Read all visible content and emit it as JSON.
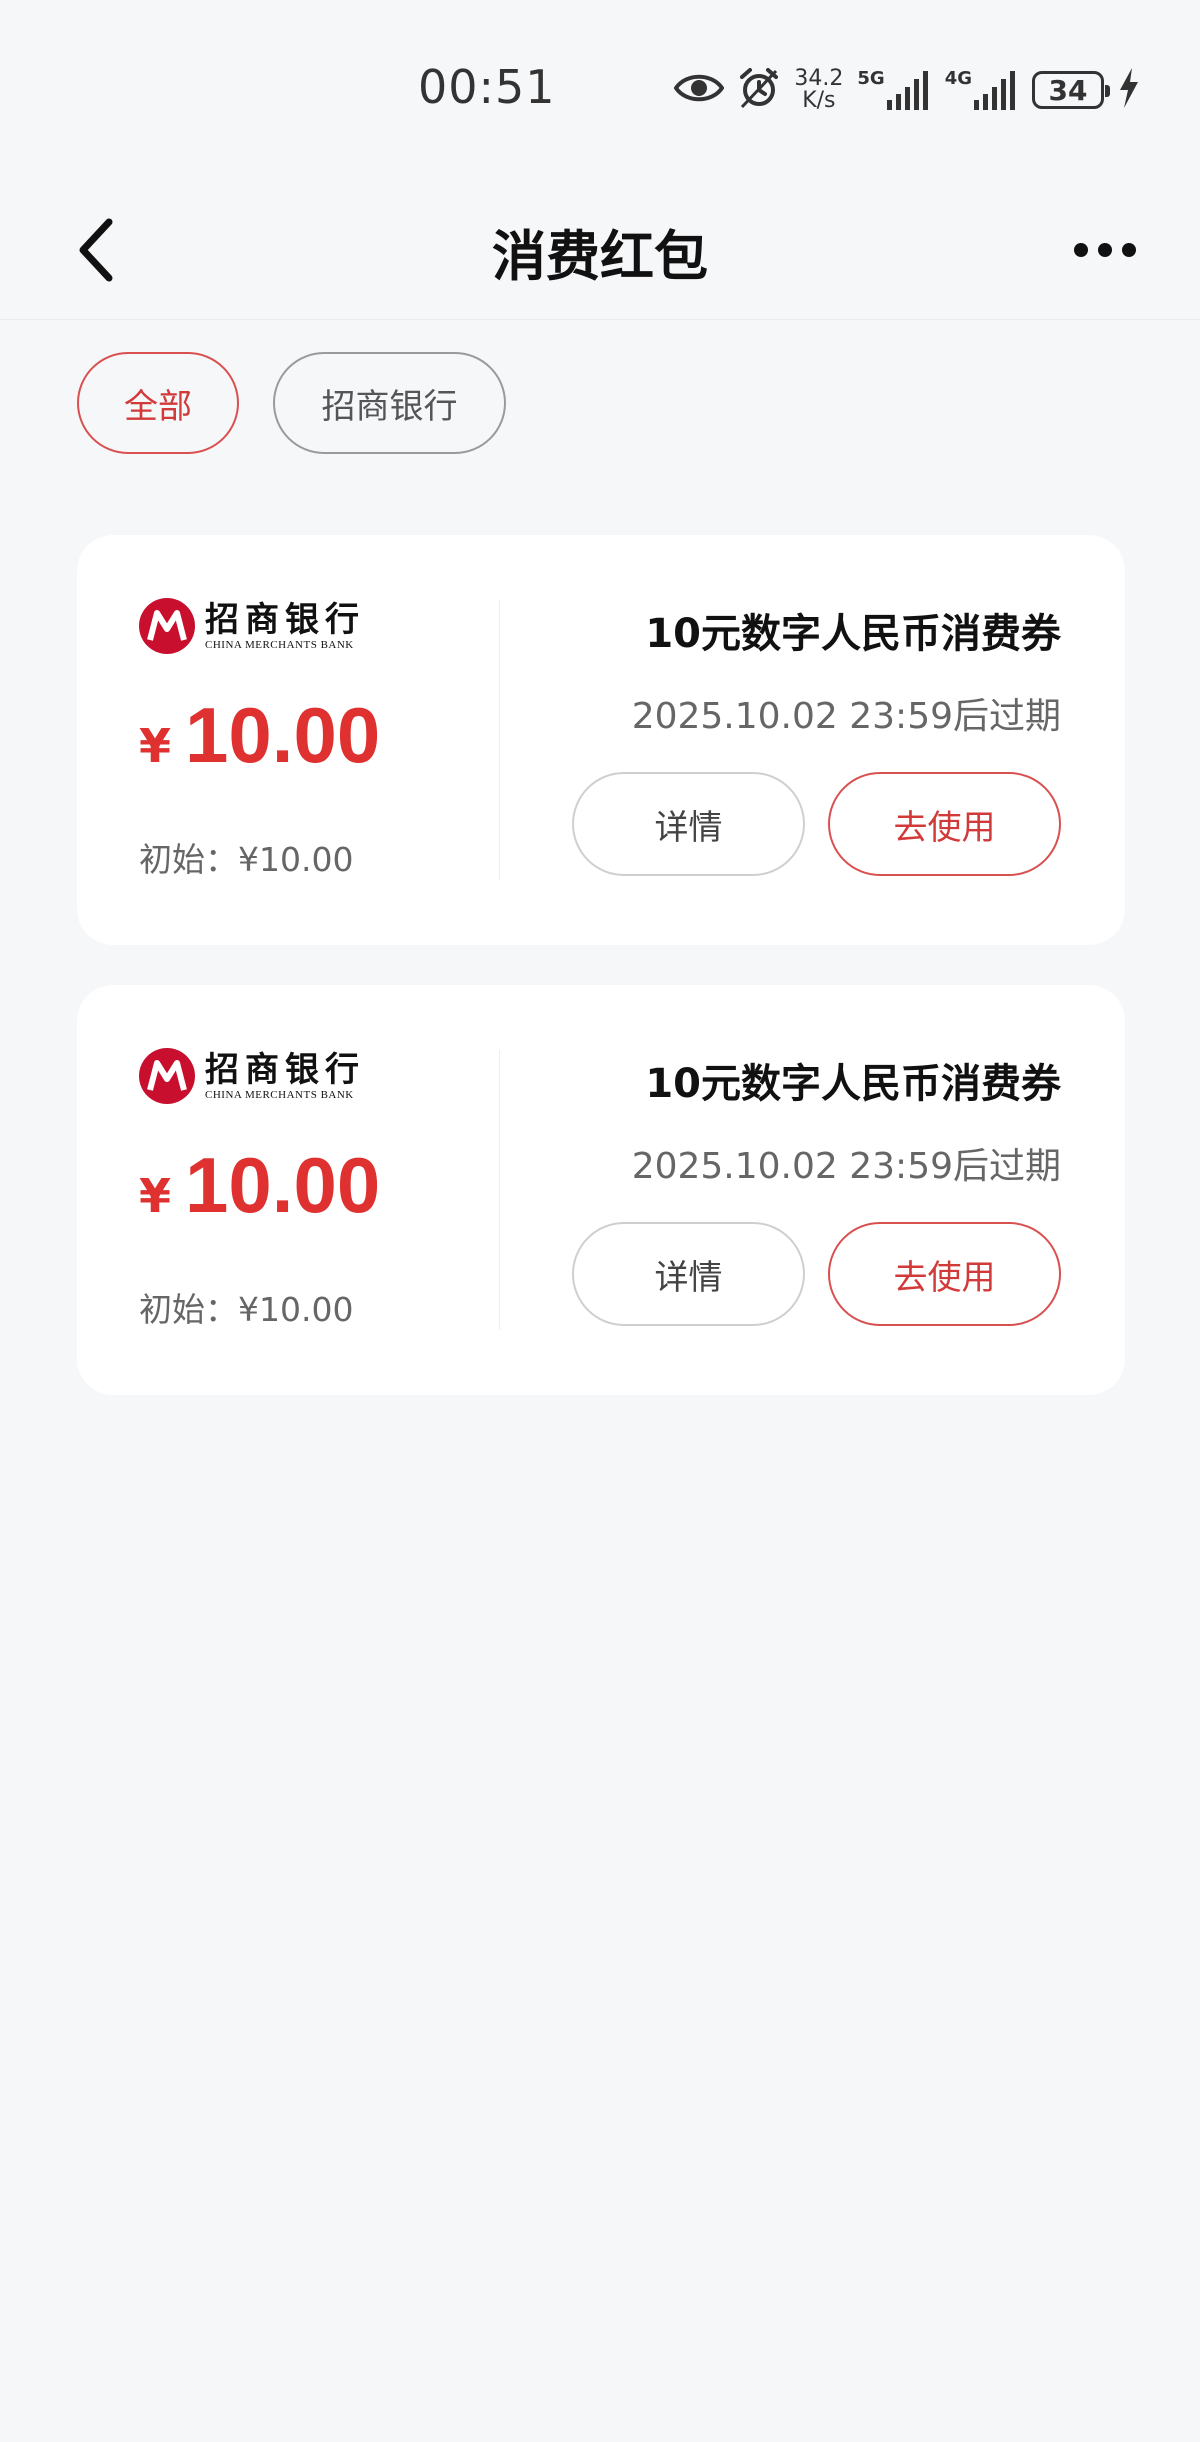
{
  "status_bar": {
    "time": "00:51",
    "net_speed_value": "34.2",
    "net_speed_unit": "K/s",
    "signal1_label": "5G",
    "signal2_label": "4G",
    "battery": "34"
  },
  "header": {
    "title": "消费红包"
  },
  "filters": [
    {
      "label": "全部",
      "active": true
    },
    {
      "label": "招商银行",
      "active": false
    }
  ],
  "cards": [
    {
      "bank_name_cn": "招商银行",
      "bank_name_en": "CHINA MERCHANTS BANK",
      "currency": "¥",
      "amount": "10.00",
      "initial": "初始：¥10.00",
      "title": "10元数字人民币消费券",
      "expiry": "2025.10.02 23:59后过期",
      "detail_label": "详情",
      "use_label": "去使用"
    },
    {
      "bank_name_cn": "招商银行",
      "bank_name_en": "CHINA MERCHANTS BANK",
      "currency": "¥",
      "amount": "10.00",
      "initial": "初始：¥10.00",
      "title": "10元数字人民币消费券",
      "expiry": "2025.10.02 23:59后过期",
      "detail_label": "详情",
      "use_label": "去使用"
    }
  ],
  "colors": {
    "accent_red": "#e03131",
    "bank_red": "#c8102e",
    "background": "#f6f7f9"
  }
}
